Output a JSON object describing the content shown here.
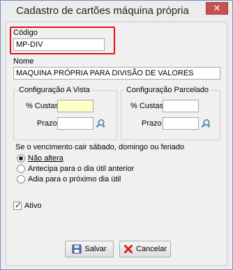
{
  "window": {
    "title": "Cadastro de cartões máquina própria",
    "close_label": "✕"
  },
  "codigo": {
    "label": "Código",
    "value": "MP-DIV"
  },
  "nome": {
    "label": "Nome",
    "value": "MAQUINA PRÓPRIA PARA DIVISÃO DE VALORES"
  },
  "config_avista": {
    "title": "Configuração A Vista",
    "custas_label": "% Custas",
    "custas_value": "",
    "prazo_label": "Prazo",
    "prazo_value": ""
  },
  "config_parcelado": {
    "title": "Configuração Parcelado",
    "custas_label": "% Custas",
    "custas_value": "",
    "prazo_label": "Prazo",
    "prazo_value": ""
  },
  "vencimento": {
    "title": "Se o vencimento cair sábado, domingo ou feriado",
    "options": [
      {
        "label": "Não altera",
        "checked": true
      },
      {
        "label": "Antecipa para o dia útil anterior",
        "checked": false
      },
      {
        "label": "Adia para o próximo dia útil",
        "checked": false
      }
    ]
  },
  "ativo": {
    "label": "Ativo",
    "checked": true
  },
  "buttons": {
    "salvar": "Salvar",
    "cancelar": "Cancelar"
  },
  "icons": {
    "search": "search-plus-icon",
    "save": "floppy-disk-icon",
    "cancel": "red-x-icon"
  }
}
